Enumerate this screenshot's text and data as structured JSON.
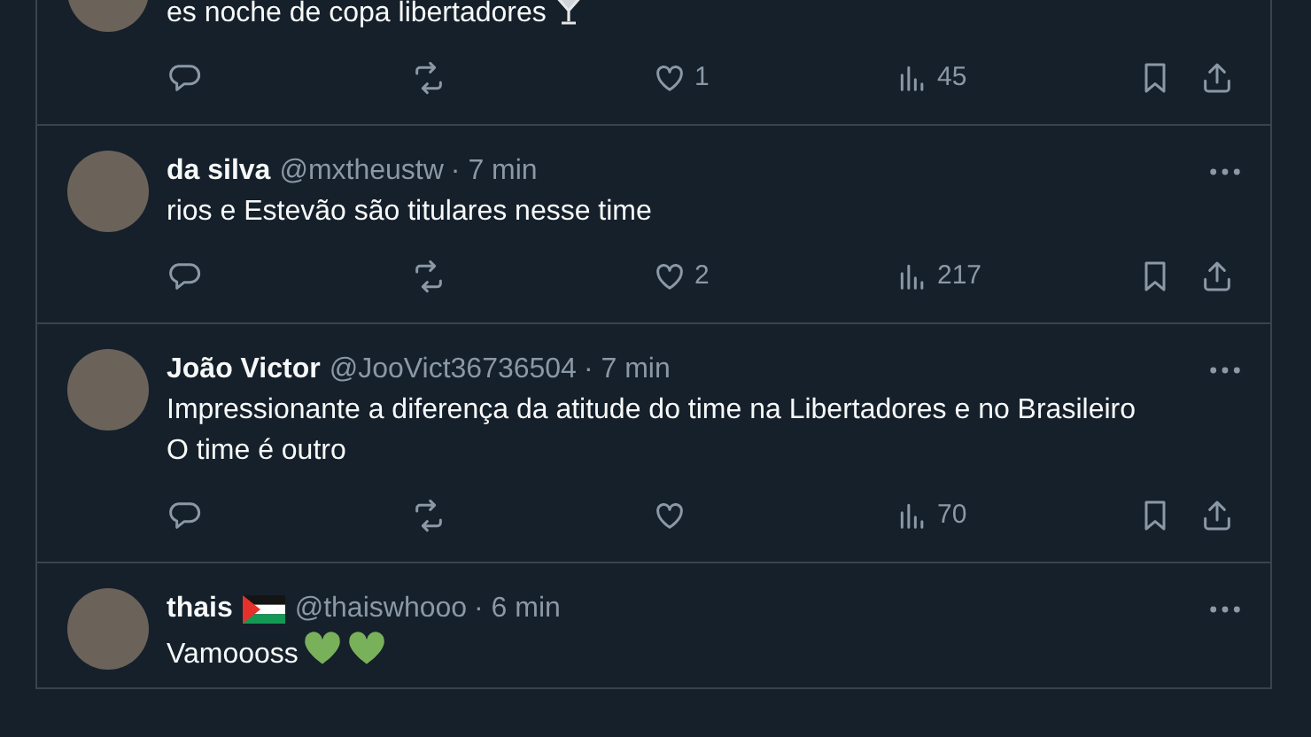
{
  "posts": [
    {
      "paragraphs": [
        "es noche de copa libertadores"
      ],
      "trailing_icons": [
        {
          "kind": "cocktail"
        }
      ],
      "stats": {
        "likes": "1",
        "views": "45"
      },
      "menu": false
    },
    {
      "header": {
        "name": "da silva",
        "handle": "@mxtheustw",
        "time": "· 7 min"
      },
      "paragraphs": [
        "rios e Estevão são titulares nesse time"
      ],
      "stats": {
        "likes": "2",
        "views": "217"
      },
      "menu": true
    },
    {
      "header": {
        "name": "João Victor",
        "handle": "@JooVict36736504",
        "time": "· 7 min"
      },
      "paragraphs": [
        "Impressionante a diferença da atitude do time na Libertadores e no Brasileiro",
        "O time é outro"
      ],
      "stats": {
        "views": "70"
      },
      "menu": true
    },
    {
      "header": {
        "name": "thais",
        "name_icons": [
          {
            "kind": "flag"
          }
        ],
        "handle": "@thaiswhooo",
        "time": "· 6 min"
      },
      "paragraphs": [
        "Vamoooss"
      ],
      "trailing_icons": [
        {
          "kind": "green-heart"
        },
        {
          "kind": "green-heart"
        }
      ],
      "menu": true
    }
  ]
}
